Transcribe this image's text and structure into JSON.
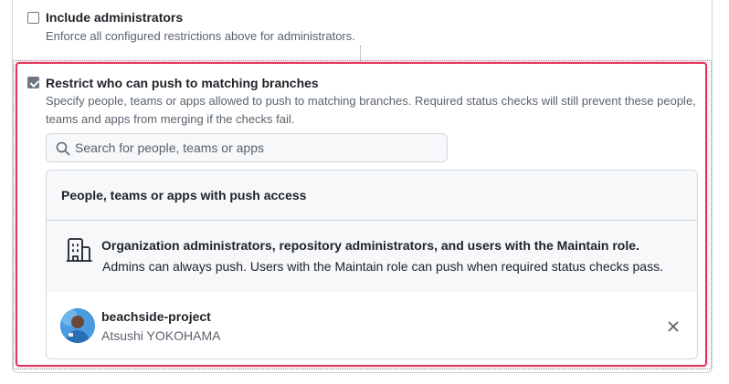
{
  "include_admins": {
    "checked": false,
    "label": "Include administrators",
    "description": "Enforce all configured restrictions above for administrators."
  },
  "restrict_push": {
    "checked": true,
    "label": "Restrict who can push to matching branches",
    "description_line1": "Specify people, teams or apps allowed to push to matching branches. Required status checks will still prevent these people,",
    "description_line2": "teams and apps from merging if the checks fail."
  },
  "search": {
    "placeholder": "Search for people, teams or apps",
    "value": "",
    "icon": "search-icon"
  },
  "push_access": {
    "header": "People, teams or apps with push access",
    "org_entry": {
      "icon": "organization-icon",
      "title": "Organization administrators, repository administrators, and users with the Maintain role.",
      "description": "Admins can always push. Users with the Maintain role can push when required status checks pass."
    },
    "users": [
      {
        "login": "beachside-project",
        "name": "Atsushi YOKOHAMA",
        "remove_icon": "close-icon"
      }
    ]
  },
  "colors": {
    "highlight": "#e0345f",
    "border": "#d0d7de",
    "muted_text": "#59636e",
    "panel_bg": "#f6f8fa"
  }
}
